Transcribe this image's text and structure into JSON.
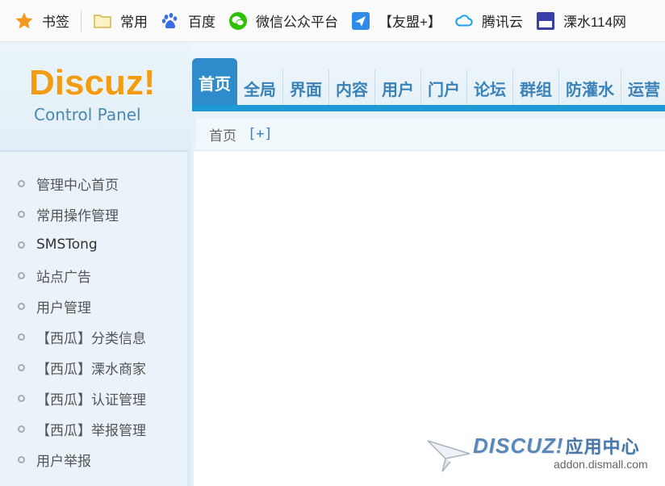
{
  "bookmarks": [
    {
      "icon": "star-icon",
      "label": "书签"
    },
    {
      "icon": "folder-icon",
      "label": "常用"
    },
    {
      "icon": "baidu-paw-icon",
      "label": "百度"
    },
    {
      "icon": "wechat-icon",
      "label": "微信公众平台"
    },
    {
      "icon": "youmeng-plane-icon",
      "label": "【友盟+】"
    },
    {
      "icon": "tencent-cloud-icon",
      "label": "腾讯云"
    },
    {
      "icon": "lishui114-logo-icon",
      "label": "溧水114网"
    }
  ],
  "logo": {
    "main": "Discuz!",
    "sub": "Control Panel"
  },
  "nav": {
    "tabs": [
      "首页",
      "全局",
      "界面",
      "内容",
      "用户",
      "门户",
      "论坛",
      "群组",
      "防灌水",
      "运营"
    ],
    "active_index": 0
  },
  "breadcrumb": {
    "home": "首页",
    "add": "[+]"
  },
  "sidebar": {
    "items": [
      "管理中心首页",
      "常用操作管理",
      "SMSTong",
      "站点广告",
      "用户管理",
      "【西瓜】分类信息",
      "【西瓜】溧水商家",
      "【西瓜】认证管理",
      "【西瓜】举报管理",
      "用户举报"
    ]
  },
  "watermark": {
    "brand": "DISCUZ!",
    "brand_cn": "应用中心",
    "url": "addon.dismall.com"
  },
  "colors": {
    "accent": "#2e8ccc",
    "nav_bar": "#1d9ad6",
    "logo_orange": "#f39c12",
    "sidebar_bg": "#eaf3f9"
  }
}
